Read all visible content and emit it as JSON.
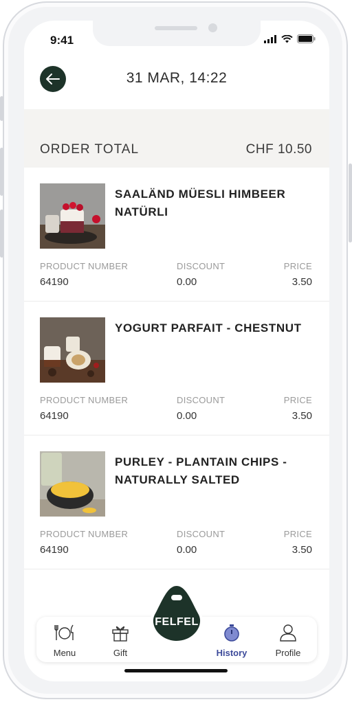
{
  "status": {
    "time": "9:41"
  },
  "header": {
    "title": "31 MAR, 14:22"
  },
  "order_total": {
    "label": "ORDER TOTAL",
    "value": "CHF 10.50"
  },
  "meta_labels": {
    "product_number": "PRODUCT NUMBER",
    "discount": "DISCOUNT",
    "price": "PRICE"
  },
  "items": [
    {
      "name": "SAALÄND MÜESLI HIMBEER NATÜRLI",
      "product_number": "64190",
      "discount": "0.00",
      "price": "3.50"
    },
    {
      "name": "YOGURT PARFAIT - CHESTNUT",
      "product_number": "64190",
      "discount": "0.00",
      "price": "3.50"
    },
    {
      "name": "PURLEY - PLANTAIN CHIPS - NATURALLY SALTED",
      "product_number": "64190",
      "discount": "0.00",
      "price": "3.50"
    }
  ],
  "tabs": [
    {
      "label": "Menu",
      "icon": "cutlery-icon"
    },
    {
      "label": "Gift",
      "icon": "gift-icon"
    },
    {
      "label": "History",
      "icon": "stopwatch-icon",
      "active": true
    },
    {
      "label": "Profile",
      "icon": "user-icon"
    }
  ],
  "brand": {
    "label": "FELFEL",
    "color": "#1d3329"
  },
  "colors": {
    "accent": "#3c4a9a",
    "dark_green": "#1d3329"
  }
}
